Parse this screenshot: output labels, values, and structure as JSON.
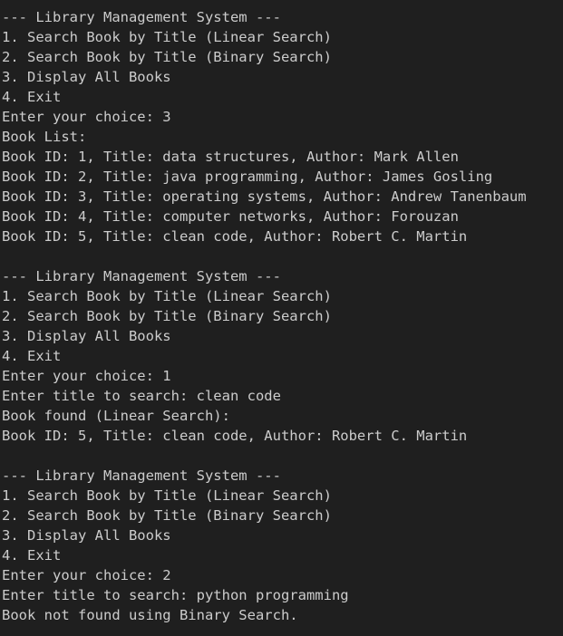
{
  "terminal": {
    "lines": [
      "--- Library Management System ---",
      "1. Search Book by Title (Linear Search)",
      "2. Search Book by Title (Binary Search)",
      "3. Display All Books",
      "4. Exit",
      "Enter your choice: 3",
      "Book List:",
      "Book ID: 1, Title: data structures, Author: Mark Allen",
      "Book ID: 2, Title: java programming, Author: James Gosling",
      "Book ID: 3, Title: operating systems, Author: Andrew Tanenbaum",
      "Book ID: 4, Title: computer networks, Author: Forouzan",
      "Book ID: 5, Title: clean code, Author: Robert C. Martin",
      "",
      "--- Library Management System ---",
      "1. Search Book by Title (Linear Search)",
      "2. Search Book by Title (Binary Search)",
      "3. Display All Books",
      "4. Exit",
      "Enter your choice: 1",
      "Enter title to search: clean code",
      "Book found (Linear Search):",
      "Book ID: 5, Title: clean code, Author: Robert C. Martin",
      "",
      "--- Library Management System ---",
      "1. Search Book by Title (Linear Search)",
      "2. Search Book by Title (Binary Search)",
      "3. Display All Books",
      "4. Exit",
      "Enter your choice: 2",
      "Enter title to search: python programming",
      "Book not found using Binary Search."
    ]
  },
  "colors": {
    "background": "#1f1f1f",
    "text": "#cccccc"
  }
}
